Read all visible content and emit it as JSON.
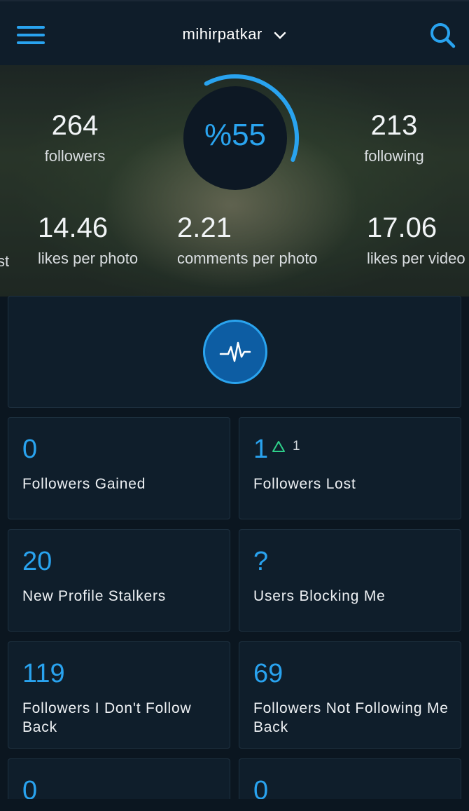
{
  "header": {
    "username": "mihirpatkar"
  },
  "stats": {
    "followers": {
      "value": "264",
      "label": "followers"
    },
    "following": {
      "value": "213",
      "label": "following"
    },
    "engagement": {
      "value": "%55",
      "percent": 55
    },
    "likes_per_photo": {
      "value": "14.46",
      "label": "likes per photo"
    },
    "comments_per_photo": {
      "value": "2.21",
      "label": "comments per photo"
    },
    "likes_per_video": {
      "value": "17.06",
      "label": "likes per video"
    },
    "cut_left_label": "st"
  },
  "cards": [
    {
      "value": "0",
      "label": "Followers Gained"
    },
    {
      "value": "1",
      "delta": "1",
      "label": "Followers Lost"
    },
    {
      "value": "20",
      "label": "New Profile Stalkers"
    },
    {
      "value": "?",
      "label": "Users Blocking Me"
    },
    {
      "value": "119",
      "label": "Followers I Don't Follow Back"
    },
    {
      "value": "69",
      "label": "Followers Not Following Me Back"
    },
    {
      "value": "0"
    },
    {
      "value": "0"
    }
  ],
  "colors": {
    "accent": "#29a3ef",
    "delta_up": "#2ecf8a",
    "background": "#0b1620"
  },
  "icons": [
    "menu-icon",
    "chevron-down-icon",
    "search-icon",
    "pulse-icon",
    "triangle-up-icon"
  ]
}
